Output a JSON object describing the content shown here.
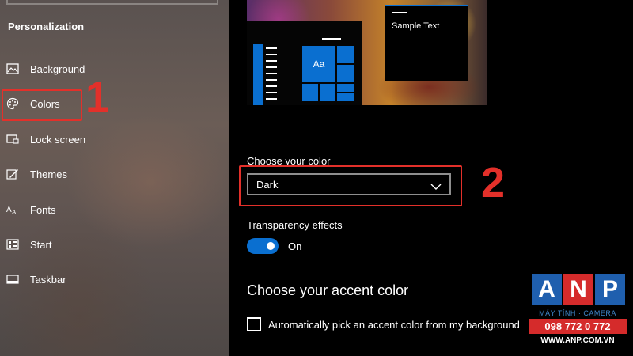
{
  "sidebar": {
    "title": "Personalization",
    "items": [
      {
        "label": "Background",
        "icon": "picture-icon"
      },
      {
        "label": "Colors",
        "icon": "palette-icon"
      },
      {
        "label": "Lock screen",
        "icon": "lock-screen-icon"
      },
      {
        "label": "Themes",
        "icon": "themes-brush-icon"
      },
      {
        "label": "Fonts",
        "icon": "fonts-icon"
      },
      {
        "label": "Start",
        "icon": "start-icon"
      },
      {
        "label": "Taskbar",
        "icon": "taskbar-icon"
      }
    ],
    "selected": "Colors"
  },
  "preview": {
    "tile_text": "Aa",
    "sample_text": "Sample Text"
  },
  "color_mode": {
    "label": "Choose your color",
    "selected": "Dark"
  },
  "transparency": {
    "label": "Transparency effects",
    "state": "On",
    "enabled": true
  },
  "accent": {
    "heading": "Choose your accent color",
    "auto_pick_label": "Automatically pick an accent color from my background",
    "auto_pick_checked": false
  },
  "annotations": {
    "step1": "1",
    "step2": "2"
  },
  "watermark": {
    "letters": [
      "A",
      "N",
      "P"
    ],
    "tagline": "MÁY TÍNH · CAMERA",
    "phone": "098 772 0 772",
    "website": "WWW.ANP.COM.VN"
  },
  "colors": {
    "accent": "#0a6fd0",
    "highlight": "#e3302a",
    "logo_blue": "#1f5fae",
    "logo_red": "#d52b2b"
  }
}
